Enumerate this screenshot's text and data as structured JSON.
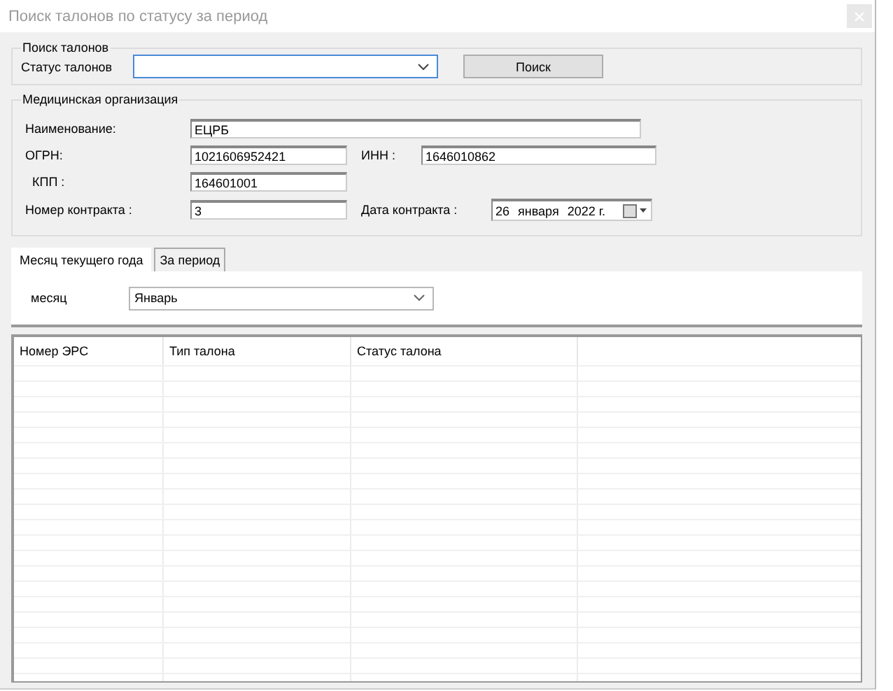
{
  "window": {
    "title": "Поиск талонов по статусу за период"
  },
  "search_group": {
    "title": "Поиск талонов",
    "status_label": "Статус талонов",
    "search_button": "Поиск"
  },
  "org_group": {
    "title": "Медицинская организация",
    "name_label": "Наименование:",
    "name_value": "ЕЦРБ",
    "ogrn_label": "ОГРН:",
    "ogrn_value": "1021606952421",
    "inn_label": "ИНН :",
    "inn_value": "1646010862",
    "kpp_label": "КПП :",
    "kpp_value": "164601001",
    "contract_label": "Номер контракта :",
    "contract_value": "3",
    "date_label": "Дата контракта :",
    "date_day": "26",
    "date_month": "января",
    "date_year": "2022 г."
  },
  "tabs": [
    {
      "label": "Месяц текущего года",
      "selected": true
    },
    {
      "label": "За период",
      "selected": false
    }
  ],
  "month": {
    "label": "месяц",
    "value": "Январь"
  },
  "table": {
    "columns": [
      "Номер ЭРС",
      "Тип талона",
      "Статус талона"
    ]
  }
}
